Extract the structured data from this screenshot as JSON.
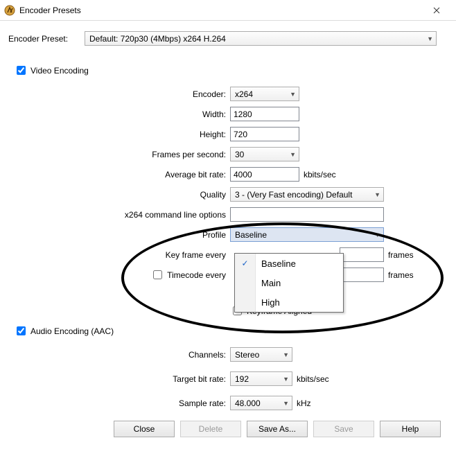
{
  "window": {
    "title": "Encoder Presets"
  },
  "preset": {
    "label": "Encoder Preset:",
    "value": "Default: 720p30 (4Mbps) x264 H.264"
  },
  "video": {
    "checkbox_label": "Video Encoding",
    "checked": true,
    "encoder_label": "Encoder:",
    "encoder_value": "x264",
    "width_label": "Width:",
    "width_value": "1280",
    "height_label": "Height:",
    "height_value": "720",
    "fps_label": "Frames per second:",
    "fps_value": "30",
    "avg_bitrate_label": "Average bit rate:",
    "avg_bitrate_value": "4000",
    "avg_bitrate_unit": "kbits/sec",
    "quality_label": "Quality",
    "quality_value": "3 - (Very Fast encoding) Default",
    "cmdline_label": "x264 command line options",
    "cmdline_value": "",
    "profile_label": "Profile",
    "profile_value": "Baseline",
    "profile_options": [
      "Baseline",
      "Main",
      "High"
    ],
    "keyframe_label": "Key frame every",
    "keyframe_unit": "frames",
    "timecode_label": "Timecode every",
    "timecode_unit": "frames",
    "keyframe_aligned_label": "Keyframe Aligned"
  },
  "audio": {
    "checkbox_label": "Audio Encoding (AAC)",
    "checked": true,
    "channels_label": "Channels:",
    "channels_value": "Stereo",
    "bitrate_label": "Target bit rate:",
    "bitrate_value": "192",
    "bitrate_unit": "kbits/sec",
    "samplerate_label": "Sample rate:",
    "samplerate_value": "48.000",
    "samplerate_unit": "kHz"
  },
  "buttons": {
    "close": "Close",
    "delete": "Delete",
    "saveas": "Save As...",
    "save": "Save",
    "help": "Help"
  }
}
